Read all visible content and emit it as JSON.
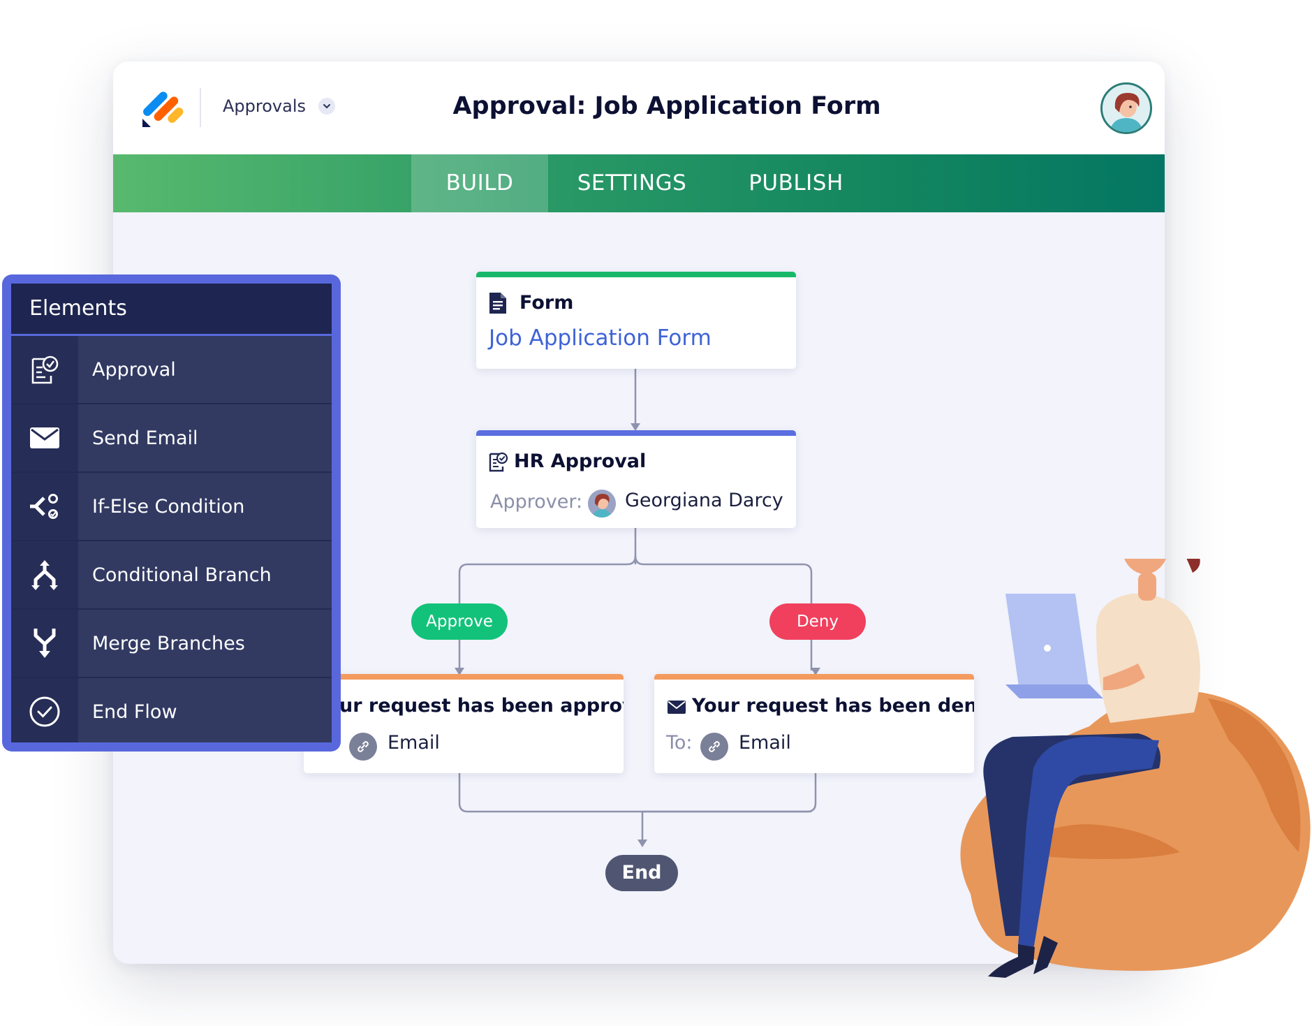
{
  "header": {
    "app_switcher_label": "Approvals",
    "page_title": "Approval: Job Application Form"
  },
  "tabs": [
    {
      "label": "BUILD",
      "active": true
    },
    {
      "label": "SETTINGS",
      "active": false
    },
    {
      "label": "PUBLISH",
      "active": false
    }
  ],
  "flow": {
    "form_node": {
      "type_label": "Form",
      "link": "Job Application Form",
      "accent": "#17b86a"
    },
    "approval_node": {
      "type_label": "HR Approval",
      "approver_label": "Approver:",
      "approver_name": "Georgiana Darcy",
      "accent": "#5a6ee0"
    },
    "approve_pill": {
      "label": "Approve",
      "color": "#13c27a"
    },
    "deny_pill": {
      "label": "Deny",
      "color": "#f0405e"
    },
    "approved_email": {
      "title": "ur request has been approved.",
      "to_label": ".",
      "link": "Email",
      "accent": "#f39a5e"
    },
    "denied_email": {
      "title": "Your request has been denied.",
      "to_label": "To:",
      "link": "Email",
      "accent": "#f39a5e"
    },
    "end_label": "End"
  },
  "elements_panel": {
    "title": "Elements",
    "items": [
      {
        "label": "Approval",
        "icon": "approval-icon"
      },
      {
        "label": "Send Email",
        "icon": "envelope-icon"
      },
      {
        "label": "If-Else Condition",
        "icon": "if-else-icon"
      },
      {
        "label": "Conditional Branch",
        "icon": "branch-icon"
      },
      {
        "label": "Merge Branches",
        "icon": "merge-icon"
      },
      {
        "label": "End Flow",
        "icon": "check-circle-icon"
      }
    ]
  },
  "colors": {
    "brand_tabbar_start": "#58b96e",
    "brand_tabbar_end": "#047663",
    "panel_border": "#5868dc",
    "panel_bg": "#323a62"
  }
}
